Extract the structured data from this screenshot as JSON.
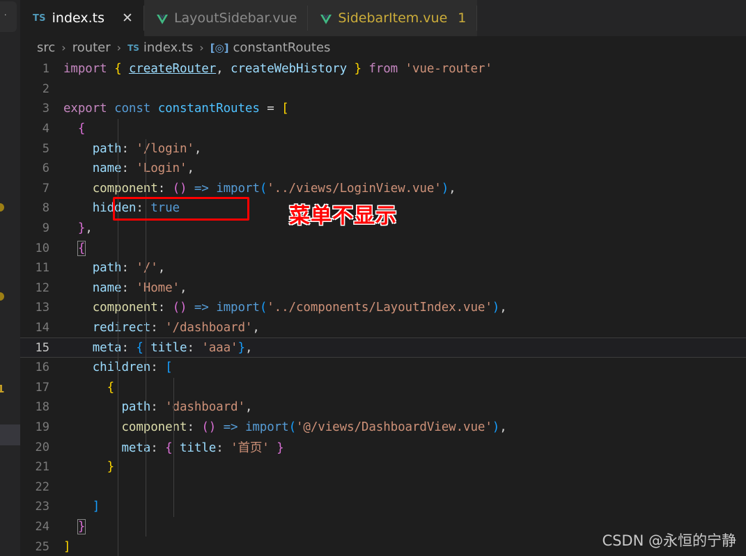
{
  "window": {
    "app": "Visual Studio Code",
    "theme_background": "#1e1e1e",
    "accent": "#519aba"
  },
  "explorer_strip": {
    "modified_badge": "1",
    "dot_glyph": "·"
  },
  "tabs": [
    {
      "icon": "typescript-icon",
      "icon_label": "TS",
      "label": "index.ts",
      "active": true,
      "modified": false,
      "close_glyph": "✕",
      "badge": ""
    },
    {
      "icon": "vue-icon",
      "icon_label": "V",
      "label": "LayoutSidebar.vue",
      "active": false,
      "modified": false,
      "close_glyph": "",
      "badge": ""
    },
    {
      "icon": "vue-icon",
      "icon_label": "V",
      "label": "SidebarItem.vue",
      "active": false,
      "modified": true,
      "close_glyph": "",
      "badge": "1"
    }
  ],
  "breadcrumb": {
    "separator": "›",
    "segments": [
      {
        "label": "src",
        "icon": ""
      },
      {
        "label": "router",
        "icon": ""
      },
      {
        "label": "index.ts",
        "icon": "typescript-icon",
        "icon_label": "TS"
      },
      {
        "label": "constantRoutes",
        "icon": "symbol-variable-icon",
        "icon_label": "[◎]"
      }
    ]
  },
  "editor": {
    "language": "typescript",
    "current_line": 15,
    "line_count": 25,
    "lines": [
      {
        "n": "1",
        "tokens": [
          {
            "t": "import",
            "c": "t-kw"
          },
          {
            "t": " ",
            "c": "t-punc"
          },
          {
            "t": "{",
            "c": "t-y"
          },
          {
            "t": " ",
            "c": "t-punc"
          },
          {
            "t": "createRouter",
            "c": "t-var-u"
          },
          {
            "t": ",",
            "c": "t-punc"
          },
          {
            "t": " ",
            "c": "t-punc"
          },
          {
            "t": "createWebHistory",
            "c": "t-var"
          },
          {
            "t": " ",
            "c": "t-punc"
          },
          {
            "t": "}",
            "c": "t-y"
          },
          {
            "t": " ",
            "c": "t-punc"
          },
          {
            "t": "from",
            "c": "t-kw"
          },
          {
            "t": " ",
            "c": "t-punc"
          },
          {
            "t": "'vue-router'",
            "c": "t-str"
          }
        ]
      },
      {
        "n": "2",
        "tokens": []
      },
      {
        "n": "3",
        "tokens": [
          {
            "t": "export",
            "c": "t-kw"
          },
          {
            "t": " ",
            "c": "t-punc"
          },
          {
            "t": "const",
            "c": "t-decl"
          },
          {
            "t": " ",
            "c": "t-punc"
          },
          {
            "t": "constantRoutes",
            "c": "t-id"
          },
          {
            "t": " ",
            "c": "t-punc"
          },
          {
            "t": "=",
            "c": "t-op"
          },
          {
            "t": " ",
            "c": "t-punc"
          },
          {
            "t": "[",
            "c": "t-y"
          }
        ]
      },
      {
        "n": "4",
        "tokens": [
          {
            "t": "  ",
            "c": "t-punc"
          },
          {
            "t": "{",
            "c": "t-p"
          }
        ]
      },
      {
        "n": "5",
        "tokens": [
          {
            "t": "    ",
            "c": "t-punc"
          },
          {
            "t": "path",
            "c": "t-var"
          },
          {
            "t": ":",
            "c": "t-punc"
          },
          {
            "t": " ",
            "c": "t-punc"
          },
          {
            "t": "'/login'",
            "c": "t-str"
          },
          {
            "t": ",",
            "c": "t-punc"
          }
        ]
      },
      {
        "n": "6",
        "tokens": [
          {
            "t": "    ",
            "c": "t-punc"
          },
          {
            "t": "name",
            "c": "t-var"
          },
          {
            "t": ":",
            "c": "t-punc"
          },
          {
            "t": " ",
            "c": "t-punc"
          },
          {
            "t": "'Login'",
            "c": "t-str"
          },
          {
            "t": ",",
            "c": "t-punc"
          }
        ]
      },
      {
        "n": "7",
        "tokens": [
          {
            "t": "    ",
            "c": "t-punc"
          },
          {
            "t": "component",
            "c": "t-fn"
          },
          {
            "t": ":",
            "c": "t-punc"
          },
          {
            "t": " ",
            "c": "t-punc"
          },
          {
            "t": "(",
            "c": "t-paren"
          },
          {
            "t": ")",
            "c": "t-paren"
          },
          {
            "t": " ",
            "c": "t-punc"
          },
          {
            "t": "=>",
            "c": "t-arrow"
          },
          {
            "t": " ",
            "c": "t-punc"
          },
          {
            "t": "import",
            "c": "t-arrow"
          },
          {
            "t": "(",
            "c": "t-b"
          },
          {
            "t": "'../views/LoginView.vue'",
            "c": "t-str"
          },
          {
            "t": ")",
            "c": "t-b"
          },
          {
            "t": ",",
            "c": "t-punc"
          }
        ]
      },
      {
        "n": "8",
        "tokens": [
          {
            "t": "    ",
            "c": "t-punc"
          },
          {
            "t": "hidden",
            "c": "t-var"
          },
          {
            "t": ":",
            "c": "t-punc"
          },
          {
            "t": " ",
            "c": "t-punc"
          },
          {
            "t": "true",
            "c": "t-arrow"
          }
        ]
      },
      {
        "n": "9",
        "tokens": [
          {
            "t": "  ",
            "c": "t-punc"
          },
          {
            "t": "}",
            "c": "t-p"
          },
          {
            "t": ",",
            "c": "t-punc"
          }
        ]
      },
      {
        "n": "10",
        "tokens": [
          {
            "t": "  ",
            "c": "t-punc"
          },
          {
            "t": "{",
            "c": "t-p bmatch"
          }
        ]
      },
      {
        "n": "11",
        "tokens": [
          {
            "t": "    ",
            "c": "t-punc"
          },
          {
            "t": "path",
            "c": "t-var"
          },
          {
            "t": ":",
            "c": "t-punc"
          },
          {
            "t": " ",
            "c": "t-punc"
          },
          {
            "t": "'/'",
            "c": "t-str"
          },
          {
            "t": ",",
            "c": "t-punc"
          }
        ]
      },
      {
        "n": "12",
        "tokens": [
          {
            "t": "    ",
            "c": "t-punc"
          },
          {
            "t": "name",
            "c": "t-var"
          },
          {
            "t": ":",
            "c": "t-punc"
          },
          {
            "t": " ",
            "c": "t-punc"
          },
          {
            "t": "'Home'",
            "c": "t-str"
          },
          {
            "t": ",",
            "c": "t-punc"
          }
        ]
      },
      {
        "n": "13",
        "tokens": [
          {
            "t": "    ",
            "c": "t-punc"
          },
          {
            "t": "component",
            "c": "t-fn"
          },
          {
            "t": ":",
            "c": "t-punc"
          },
          {
            "t": " ",
            "c": "t-punc"
          },
          {
            "t": "(",
            "c": "t-paren"
          },
          {
            "t": ")",
            "c": "t-paren"
          },
          {
            "t": " ",
            "c": "t-punc"
          },
          {
            "t": "=>",
            "c": "t-arrow"
          },
          {
            "t": " ",
            "c": "t-punc"
          },
          {
            "t": "import",
            "c": "t-arrow"
          },
          {
            "t": "(",
            "c": "t-b"
          },
          {
            "t": "'../components/LayoutIndex.vue'",
            "c": "t-str"
          },
          {
            "t": ")",
            "c": "t-b"
          },
          {
            "t": ",",
            "c": "t-punc"
          }
        ]
      },
      {
        "n": "14",
        "tokens": [
          {
            "t": "    ",
            "c": "t-punc"
          },
          {
            "t": "redirect",
            "c": "t-var"
          },
          {
            "t": ":",
            "c": "t-punc"
          },
          {
            "t": " ",
            "c": "t-punc"
          },
          {
            "t": "'/dashboard'",
            "c": "t-str"
          },
          {
            "t": ",",
            "c": "t-punc"
          }
        ]
      },
      {
        "n": "15",
        "tokens": [
          {
            "t": "    ",
            "c": "t-punc"
          },
          {
            "t": "meta",
            "c": "t-var"
          },
          {
            "t": ":",
            "c": "t-punc"
          },
          {
            "t": " ",
            "c": "t-punc"
          },
          {
            "t": "{",
            "c": "t-b"
          },
          {
            "t": " ",
            "c": "t-punc"
          },
          {
            "t": "title",
            "c": "t-var"
          },
          {
            "t": ":",
            "c": "t-punc"
          },
          {
            "t": " ",
            "c": "t-punc"
          },
          {
            "t": "'aaa'",
            "c": "t-str"
          },
          {
            "t": "}",
            "c": "t-b"
          },
          {
            "t": ",",
            "c": "t-punc"
          }
        ]
      },
      {
        "n": "16",
        "tokens": [
          {
            "t": "    ",
            "c": "t-punc"
          },
          {
            "t": "children",
            "c": "t-var"
          },
          {
            "t": ":",
            "c": "t-punc"
          },
          {
            "t": " ",
            "c": "t-punc"
          },
          {
            "t": "[",
            "c": "t-b"
          }
        ]
      },
      {
        "n": "17",
        "tokens": [
          {
            "t": "      ",
            "c": "t-punc"
          },
          {
            "t": "{",
            "c": "t-y"
          }
        ]
      },
      {
        "n": "18",
        "tokens": [
          {
            "t": "        ",
            "c": "t-punc"
          },
          {
            "t": "path",
            "c": "t-var"
          },
          {
            "t": ":",
            "c": "t-punc"
          },
          {
            "t": " ",
            "c": "t-punc"
          },
          {
            "t": "'dashboard'",
            "c": "t-str"
          },
          {
            "t": ",",
            "c": "t-punc"
          }
        ]
      },
      {
        "n": "19",
        "tokens": [
          {
            "t": "        ",
            "c": "t-punc"
          },
          {
            "t": "component",
            "c": "t-fn"
          },
          {
            "t": ":",
            "c": "t-punc"
          },
          {
            "t": " ",
            "c": "t-punc"
          },
          {
            "t": "(",
            "c": "t-paren"
          },
          {
            "t": ")",
            "c": "t-paren"
          },
          {
            "t": " ",
            "c": "t-punc"
          },
          {
            "t": "=>",
            "c": "t-arrow"
          },
          {
            "t": " ",
            "c": "t-punc"
          },
          {
            "t": "import",
            "c": "t-arrow"
          },
          {
            "t": "(",
            "c": "t-b"
          },
          {
            "t": "'@/views/DashboardView.vue'",
            "c": "t-str"
          },
          {
            "t": ")",
            "c": "t-b"
          },
          {
            "t": ",",
            "c": "t-punc"
          }
        ]
      },
      {
        "n": "20",
        "tokens": [
          {
            "t": "        ",
            "c": "t-punc"
          },
          {
            "t": "meta",
            "c": "t-var"
          },
          {
            "t": ":",
            "c": "t-punc"
          },
          {
            "t": " ",
            "c": "t-punc"
          },
          {
            "t": "{",
            "c": "t-p"
          },
          {
            "t": " ",
            "c": "t-punc"
          },
          {
            "t": "title",
            "c": "t-var"
          },
          {
            "t": ":",
            "c": "t-punc"
          },
          {
            "t": " ",
            "c": "t-punc"
          },
          {
            "t": "'首页'",
            "c": "t-str"
          },
          {
            "t": " ",
            "c": "t-punc"
          },
          {
            "t": "}",
            "c": "t-p"
          }
        ]
      },
      {
        "n": "21",
        "tokens": [
          {
            "t": "      ",
            "c": "t-punc"
          },
          {
            "t": "}",
            "c": "t-y"
          }
        ]
      },
      {
        "n": "22",
        "tokens": []
      },
      {
        "n": "23",
        "tokens": [
          {
            "t": "    ",
            "c": "t-punc"
          },
          {
            "t": "]",
            "c": "t-b"
          }
        ]
      },
      {
        "n": "24",
        "tokens": [
          {
            "t": "  ",
            "c": "t-punc"
          },
          {
            "t": "}",
            "c": "t-p bmatch"
          }
        ]
      },
      {
        "n": "25",
        "tokens": [
          {
            "t": "",
            "c": "t-punc"
          },
          {
            "t": "]",
            "c": "t-y"
          }
        ]
      }
    ]
  },
  "annotations": {
    "highlight_box_target": "hidden: true",
    "note_text": "菜单不显示",
    "note_color": "#ff0000",
    "box_color": "#ff0000"
  },
  "watermark": {
    "text": "CSDN @永恒的宁静"
  }
}
